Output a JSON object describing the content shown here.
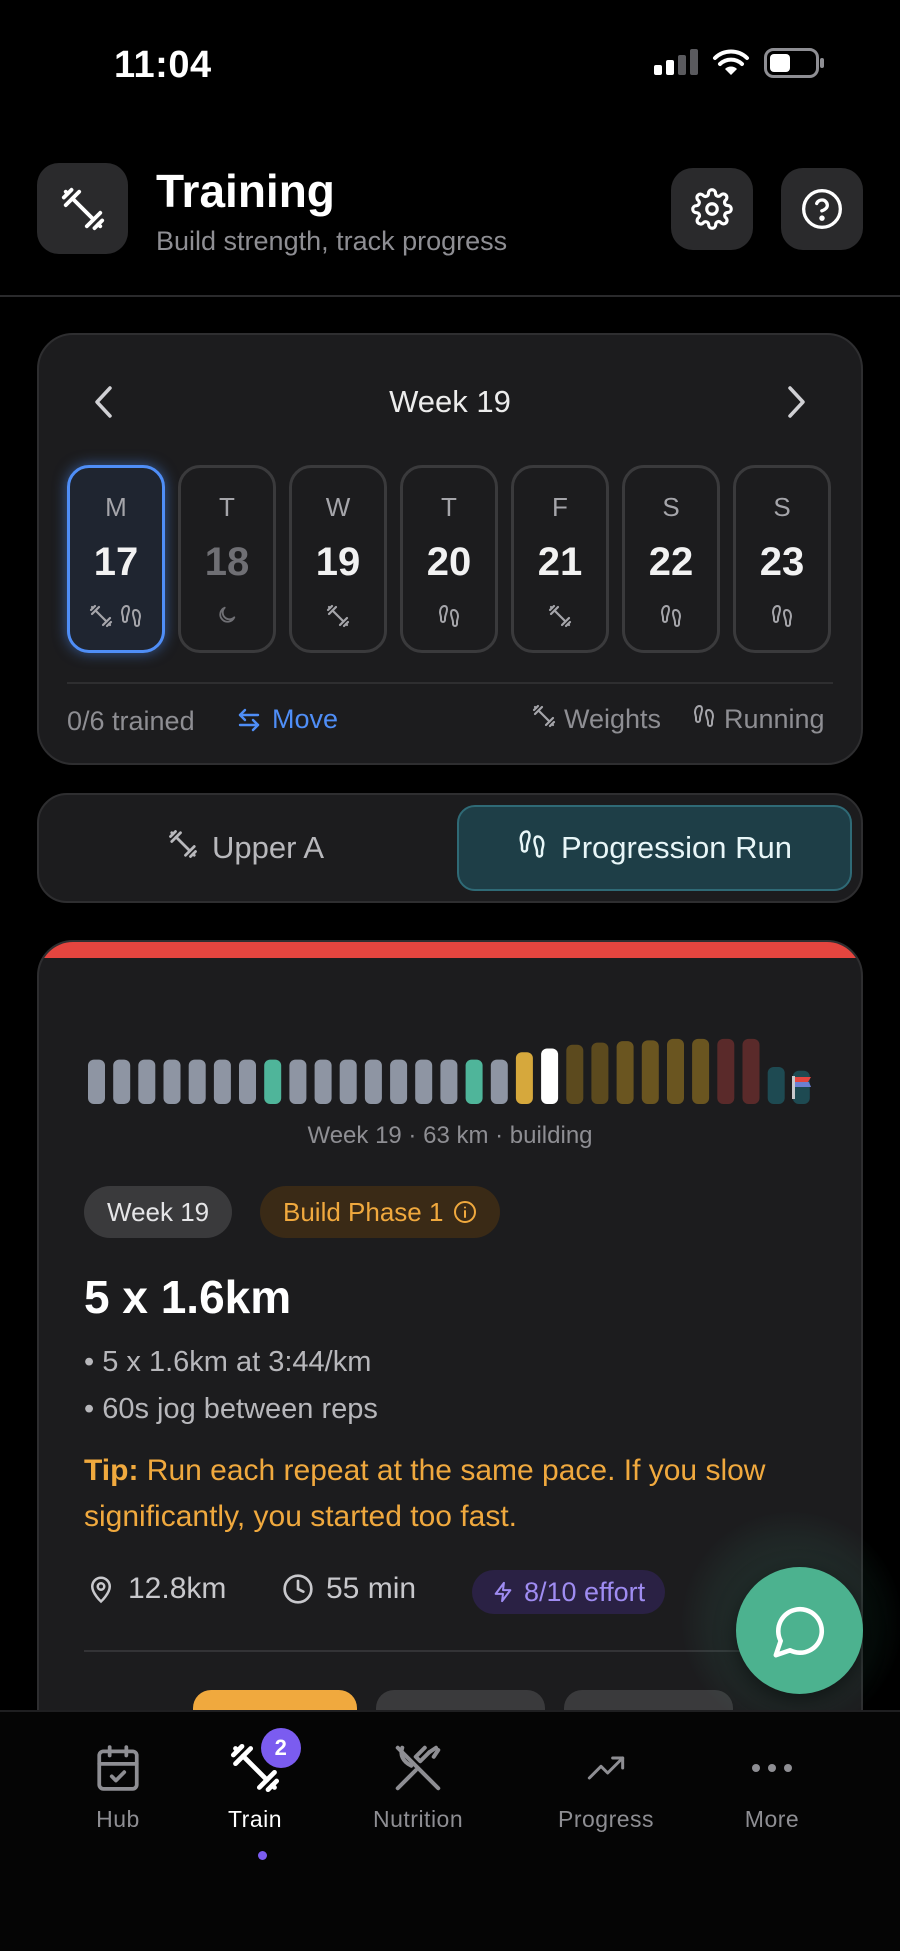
{
  "status_bar": {
    "time": "11:04"
  },
  "header": {
    "title": "Training",
    "subtitle": "Build strength, track progress"
  },
  "calendar": {
    "week_label": "Week 19",
    "days": [
      {
        "letter": "M",
        "num": "17",
        "icons": [
          "dumbbell-icon",
          "footprints-icon"
        ],
        "selected": true
      },
      {
        "letter": "T",
        "num": "18",
        "icons": [
          "moon-icon"
        ],
        "rest": true
      },
      {
        "letter": "W",
        "num": "19",
        "icons": [
          "dumbbell-icon"
        ]
      },
      {
        "letter": "T",
        "num": "20",
        "icons": [
          "footprints-icon"
        ]
      },
      {
        "letter": "F",
        "num": "21",
        "icons": [
          "dumbbell-icon"
        ]
      },
      {
        "letter": "S",
        "num": "22",
        "icons": [
          "footprints-icon"
        ]
      },
      {
        "letter": "S",
        "num": "23",
        "icons": [
          "footprints-icon"
        ]
      }
    ],
    "trained": "0/6 trained",
    "move_label": "Move",
    "legend_weights": "Weights",
    "legend_running": "Running"
  },
  "tabs": {
    "upper": "Upper A",
    "run": "Progression Run"
  },
  "workout": {
    "accent_color": "#e4453f",
    "chart_caption": "Week 19 · 63 km · building",
    "week_pill": "Week 19",
    "phase_pill": "Build Phase 1",
    "title": "5 x 1.6km",
    "bullets": [
      "• 5 x 1.6km at 3:44/km",
      "• 60s jog between reps"
    ],
    "tip_label": "Tip:",
    "tip_text": " Run each repeat at the same pace. If you slow significantly, you started too fast.",
    "distance": "12.8km",
    "duration": "55 min",
    "effort": "8/10 effort"
  },
  "chart_data": {
    "type": "bar",
    "series": [
      {
        "values": [
          0.6,
          0.6,
          0.6,
          0.6,
          0.6,
          0.6,
          0.6,
          0.6,
          0.6,
          0.6,
          0.6,
          0.6,
          0.6,
          0.6,
          0.6,
          0.6,
          0.6,
          0.7,
          0.75,
          0.8,
          0.83,
          0.85,
          0.86,
          0.88,
          0.88,
          0.88,
          0.88,
          0.5,
          0.45
        ],
        "colors": [
          "#8e95a3",
          "#8e95a3",
          "#8e95a3",
          "#8e95a3",
          "#8e95a3",
          "#8e95a3",
          "#8e95a3",
          "#4fb59a",
          "#8e95a3",
          "#8e95a3",
          "#8e95a3",
          "#8e95a3",
          "#8e95a3",
          "#8e95a3",
          "#8e95a3",
          "#4fb59a",
          "#8e95a3",
          "#d6a83c",
          "#ffffff",
          "#5c4a1e",
          "#5c4a1e",
          "#6a5520",
          "#6a5520",
          "#6a5520",
          "#6a5520",
          "#5a2a2a",
          "#5a2a2a",
          "#1e4a52",
          "#1e4a52"
        ]
      }
    ]
  },
  "nav": [
    {
      "label": "Hub",
      "icon": "calendar-check-icon"
    },
    {
      "label": "Train",
      "icon": "dumbbell-icon",
      "badge": "2",
      "active": true
    },
    {
      "label": "Nutrition",
      "icon": "utensils-icon"
    },
    {
      "label": "Progress",
      "icon": "trending-up-icon"
    },
    {
      "label": "More",
      "icon": "more-dots-icon"
    }
  ]
}
